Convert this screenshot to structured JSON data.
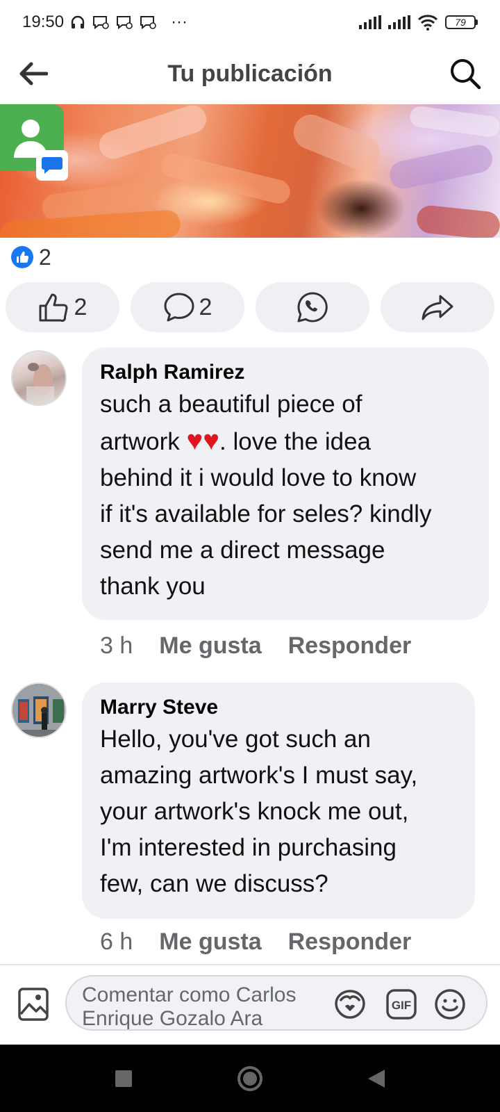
{
  "status_bar": {
    "time": "19:50",
    "more": "···",
    "battery": "79"
  },
  "header": {
    "title": "Tu publicación",
    "back_icon": "arrow-left-icon",
    "search_icon": "search-icon"
  },
  "post": {
    "reaction_count": "2",
    "actions": [
      {
        "icon": "thumbs-up-icon",
        "count": "2"
      },
      {
        "icon": "comment-icon",
        "count": "2"
      },
      {
        "icon": "whatsapp-icon",
        "count": ""
      },
      {
        "icon": "share-icon",
        "count": ""
      }
    ]
  },
  "comments": [
    {
      "author": "Ralph Ramirez",
      "lines": [
        "such a beautiful piece of",
        "artwork ♥♥. love the idea",
        "behind it i would love to know",
        "if it's available for seles? kindly",
        "send me a direct message",
        "thank you"
      ],
      "time": "3 h",
      "like_label": "Me gusta",
      "reply_label": "Responder"
    },
    {
      "author": "Marry Steve",
      "lines": [
        "Hello, you've got such an",
        "amazing artwork's I must say,",
        "your artwork's knock me out,",
        "I'm interested in purchasing",
        "few, can we discuss?"
      ],
      "time": "6 h",
      "like_label": "Me gusta",
      "reply_label": "Responder"
    }
  ],
  "composer": {
    "placeholder_line1": "Comentar como Carlos",
    "placeholder_line2": "Enrique Gozalo Ara",
    "gif_label": "GIF"
  },
  "colors": {
    "accent": "#1877f2",
    "pill_bg": "#eff0f4",
    "bubble_bg": "#f0f1f5",
    "meta_text": "#65676b",
    "heart": "#e0161e"
  }
}
